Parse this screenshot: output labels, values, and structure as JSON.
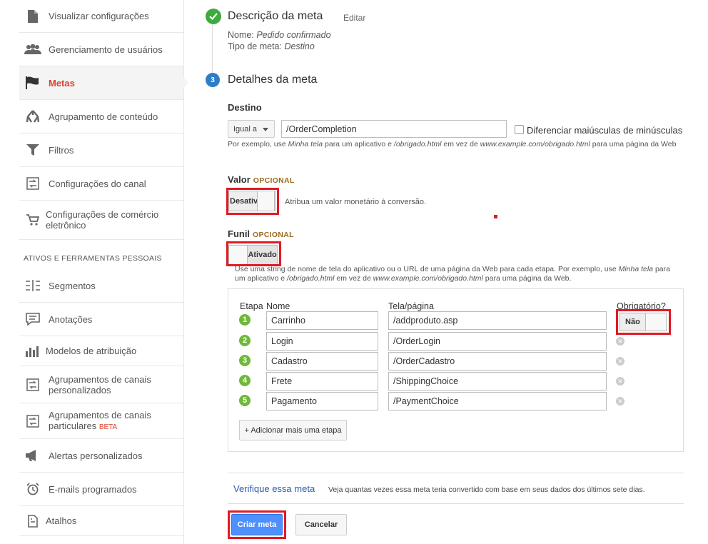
{
  "sidebar": {
    "items": [
      {
        "label": "Visualizar configurações",
        "icon": "document-icon"
      },
      {
        "label": "Gerenciamento de usuários",
        "icon": "users-icon"
      },
      {
        "label": "Metas",
        "icon": "flag-icon"
      },
      {
        "label": "Agrupamento de conteúdo",
        "icon": "grouping-icon"
      },
      {
        "label": "Filtros",
        "icon": "filter-icon"
      },
      {
        "label": "Configurações do canal",
        "icon": "channel-icon"
      },
      {
        "label": "Configurações de comércio eletrônico",
        "icon": "cart-icon"
      }
    ],
    "section_title": "ATIVOS E FERRAMENTAS PESSOAIS",
    "tools": [
      {
        "label": "Segmentos",
        "icon": "segments-icon"
      },
      {
        "label": "Anotações",
        "icon": "annotation-icon"
      },
      {
        "label": "Modelos de atribuição",
        "icon": "bar-chart-icon"
      },
      {
        "label": "Agrupamentos de canais personalizados",
        "icon": "channel-group-icon"
      },
      {
        "label": "Agrupamentos de canais particulares",
        "badge": "BETA",
        "icon": "channel-group-icon"
      },
      {
        "label": "Alertas personalizados",
        "icon": "megaphone-icon"
      },
      {
        "label": "E-mails programados",
        "icon": "alarm-clock-icon"
      },
      {
        "label": "Atalhos",
        "icon": "shortcut-icon"
      }
    ]
  },
  "goal_description": {
    "title": "Descrição da meta",
    "edit_label": "Editar",
    "name_label": "Nome:",
    "name_value": "Pedido confirmado",
    "type_label": "Tipo de meta:",
    "type_value": "Destino"
  },
  "goal_details": {
    "step_number": "3",
    "title": "Detalhes da meta",
    "destination": {
      "label": "Destino",
      "match_type": "Igual a",
      "value": "/OrderCompletion",
      "case_sensitive_label": "Diferenciar maiúsculas de minúsculas",
      "hint_prefix": "Por exemplo, use ",
      "hint_em1": "Minha tela",
      "hint_mid1": " para um aplicativo e ",
      "hint_em2": "/obrigado.html",
      "hint_mid2": " em vez de ",
      "hint_em3": "www.example.com/obrigado.html",
      "hint_suffix": " para uma página da Web"
    },
    "value": {
      "label": "Valor",
      "optional": "OPCIONAL",
      "toggle_text": "Desativ",
      "description": "Atribua um valor monetário à conversão."
    },
    "funnel": {
      "label": "Funil",
      "optional": "OPCIONAL",
      "toggle_text": "Ativado",
      "hint_prefix": "Use uma string de nome de tela do aplicativo ou o URL de uma página da Web para cada etapa. Por exemplo, use ",
      "hint_em1": "Minha tela",
      "hint_mid1": " para um aplicativo e ",
      "hint_em2": "/obrigado.html",
      "hint_mid2": " em vez de ",
      "hint_em3": "www.example.com/obrigado.html",
      "hint_suffix": " para uma página da Web.",
      "columns": {
        "step": "Etapa",
        "name": "Nome",
        "page": "Tela/página",
        "required": "Obrigatório?"
      },
      "required_toggle": "Não",
      "steps": [
        {
          "num": "1",
          "name": "Carrinho",
          "page": "/addproduto.asp"
        },
        {
          "num": "2",
          "name": "Login",
          "page": "/OrderLogin"
        },
        {
          "num": "3",
          "name": "Cadastro",
          "page": "/OrderCadastro"
        },
        {
          "num": "4",
          "name": "Frete",
          "page": "/ShippingChoice"
        },
        {
          "num": "5",
          "name": "Pagamento",
          "page": "/PaymentChoice"
        }
      ],
      "add_step_label": "+ Adicionar mais uma etapa"
    }
  },
  "verify": {
    "link": "Verifique essa meta",
    "description": "Veja quantas vezes essa meta teria convertido com base em seus dados dos últimos sete dias."
  },
  "actions": {
    "create": "Criar meta",
    "cancel": "Cancelar"
  },
  "colors": {
    "accent_blue": "#4d90fe",
    "highlight_red": "#e11a24",
    "active_nav": "#d9412e",
    "step_green": "#6fb83a"
  }
}
